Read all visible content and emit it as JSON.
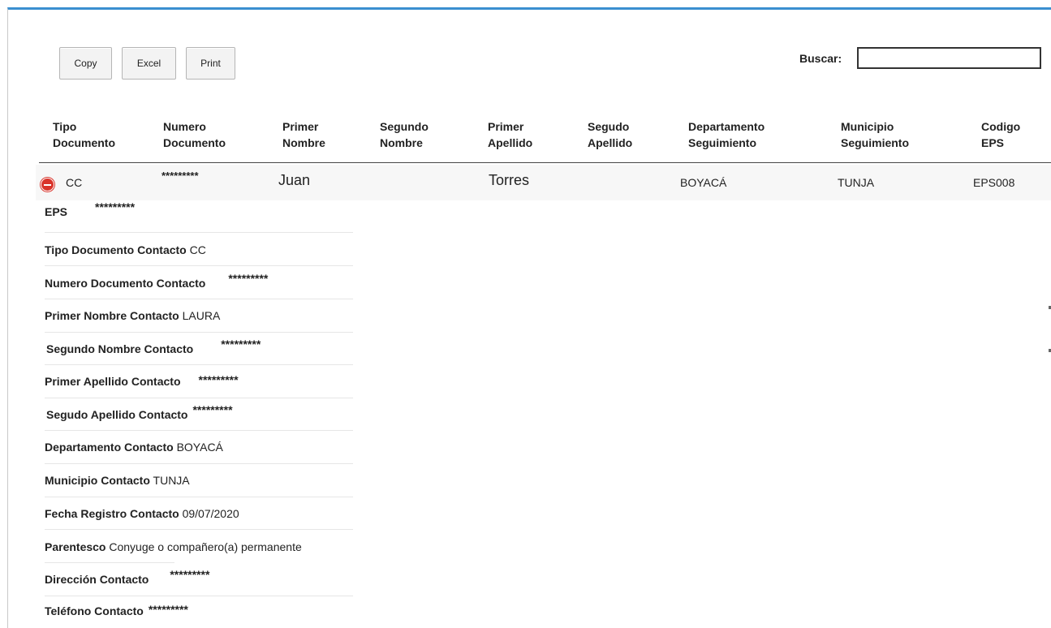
{
  "toolbar": {
    "copy_label": "Copy",
    "excel_label": "Excel",
    "print_label": "Print"
  },
  "search": {
    "label": "Buscar:",
    "value": ""
  },
  "columns": [
    [
      "Tipo",
      "Documento"
    ],
    [
      "Numero",
      "Documento"
    ],
    [
      "Primer",
      "Nombre"
    ],
    [
      "Segundo",
      "Nombre"
    ],
    [
      "Primer",
      "Apellido"
    ],
    [
      "Segudo",
      "Apellido"
    ],
    [
      "Departamento",
      "Seguimiento"
    ],
    [
      "Municipio",
      "Seguimiento"
    ],
    [
      "Codigo",
      "EPS"
    ]
  ],
  "row": {
    "tipo_documento": "CC",
    "numero_documento": "*********",
    "primer_nombre": "Juan",
    "segundo_nombre": "",
    "primer_apellido": "Torres",
    "segundo_apellido": "",
    "departamento": "BOYACÁ",
    "municipio": "TUNJA",
    "codigo_eps": "EPS008"
  },
  "details": [
    {
      "label": "EPS",
      "value": "*********"
    },
    {
      "label": "Tipo Documento Contacto",
      "value": "CC"
    },
    {
      "label": "Numero Documento Contacto",
      "value": "*********"
    },
    {
      "label": "Primer Nombre Contacto",
      "value": "LAURA"
    },
    {
      "label": "Segundo Nombre Contacto",
      "value": "*********"
    },
    {
      "label": "Primer Apellido Contacto",
      "value": "*********"
    },
    {
      "label": "Segudo Apellido Contacto",
      "value": "*********"
    },
    {
      "label": "Departamento Contacto",
      "value": "BOYACÁ"
    },
    {
      "label": "Municipio Contacto",
      "value": "TUNJA"
    },
    {
      "label": "Fecha Registro Contacto",
      "value": "09/07/2020"
    },
    {
      "label": "Parentesco",
      "value": "Conyuge o compañero(a) permanente"
    },
    {
      "label": "Dirección Contacto",
      "value": "*********"
    },
    {
      "label": "Teléfono Contacto",
      "value": "*********"
    }
  ],
  "colors": {
    "accent": "#3a8fd0",
    "collapse_button": "#d9342b",
    "row_background": "#f7f7f7"
  }
}
